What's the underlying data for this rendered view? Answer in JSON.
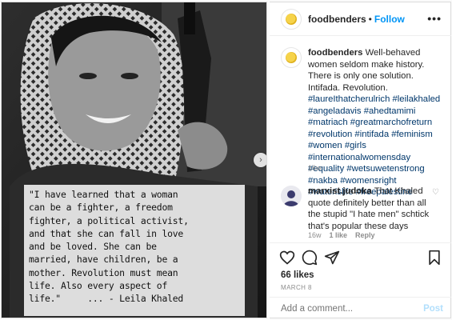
{
  "post": {
    "quote": "\"I have learned that a woman\ncan be a fighter, a freedom\nfighter, a political activist,\nand that she can fall in love\nand be loved. She can be\nmarried, have children, be a\nmother. Revolution must mean\nlife. Also every aspect of\nlife.\"     ... - Leila Khaled"
  },
  "header": {
    "username": "foodbenders",
    "separator": "•",
    "follow_label": "Follow",
    "more_label": "•••"
  },
  "caption": {
    "username": "foodbenders",
    "text": "Well-behaved women seldom make history. There is only one solution. Intifada. Revolution.",
    "hashtags": [
      "#laureIthatcherulrich",
      "#leilakhaled",
      "#angeladavis",
      "#ahedtamimi",
      "#matriach",
      "#greatmarchofreturn",
      "#revolution",
      "#intifada",
      "#feminism",
      "#women",
      "#girls",
      "#internationalwomensday",
      "#equality",
      "#wetsuwetenstrong",
      "#nakba",
      "#womensright",
      "#waterislife",
      "#freepalestine"
    ],
    "time": "16w"
  },
  "comment": {
    "username": "marxist.judoka",
    "text": "That Khaled quote definitely better than all the stupid \"I hate men\" schtick that's popular these days",
    "time": "16w",
    "likes": "1 like",
    "reply": "Reply"
  },
  "stats": {
    "likes": "66 likes",
    "date": "MARCH 8"
  },
  "add_comment": {
    "placeholder": "Add a comment...",
    "post_label": "Post"
  },
  "colors": {
    "link": "#00376b",
    "follow": "#0095f6",
    "muted": "#8e8e8e"
  }
}
